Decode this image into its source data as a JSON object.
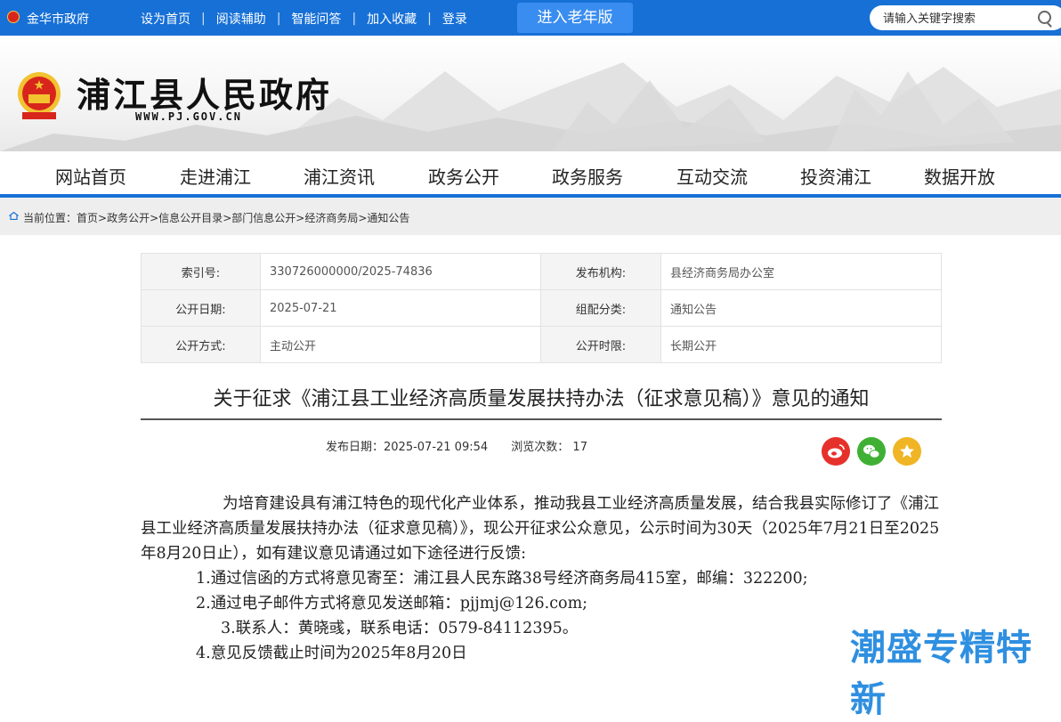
{
  "topbar": {
    "city": "金华市政府",
    "links": [
      "设为首页",
      "阅读辅助",
      "智能问答",
      "加入收藏",
      "登录"
    ],
    "separator": "|",
    "elder_mode": "进入老年版",
    "search_placeholder": "请输入关键字搜索"
  },
  "header": {
    "site_name": "浦江县人民政府",
    "domain": "WWW.PJ.GOV.CN"
  },
  "nav": [
    "网站首页",
    "走进浦江",
    "浦江资讯",
    "政务公开",
    "政务服务",
    "互动交流",
    "投资浦江",
    "数据开放"
  ],
  "breadcrumb": {
    "prefix": "当前位置：",
    "items": [
      "首页",
      "政务公开",
      "信息公开目录",
      "部门信息公开",
      "经济商务局",
      "通知公告"
    ],
    "separator": ">"
  },
  "meta": [
    {
      "k1": "索引号:",
      "v1": "330726000000/2025-74836",
      "k2": "发布机构:",
      "v2": "县经济商务局办公室"
    },
    {
      "k1": "公开日期:",
      "v1": "2025-07-21",
      "k2": "组配分类:",
      "v2": "通知公告"
    },
    {
      "k1": "公开方式:",
      "v1": "主动公开",
      "k2": "公开时限:",
      "v2": "长期公开"
    }
  ],
  "article": {
    "title": "关于征求《浦江县工业经济高质量发展扶持办法（征求意见稿）》意见的通知",
    "publish_date": "发布日期：2025-07-21 09:54",
    "views": "浏览次数：  17",
    "para1": "为培育建设具有浦江特色的现代化产业体系，推动我县工业经济高质量发展，结合我县实际修订了《浦江县工业经济高质量发展扶持办法（征求意见稿）》，现公开征求公众意见，公示时间为30天（2025年7月21日至2025年8月20日止），如有建议意见请通过如下途径进行反馈:",
    "item1": "1.通过信函的方式将意见寄至：浦江县人民东路38号经济商务局415室，邮编：322200;",
    "item2": "2.通过电子邮件方式将意见发送邮箱：pjjmj@126.com;",
    "item3": "3.联系人：黄晓彧，联系电话：0579-84112395。",
    "item4": "4.意见反馈截止时间为2025年8月20日"
  },
  "watermark": "潮盛专精特新",
  "colors": {
    "brand_blue": "#1770d6",
    "weibo": "#e6312a",
    "wechat": "#3fb034",
    "favorite": "#f0b525"
  }
}
